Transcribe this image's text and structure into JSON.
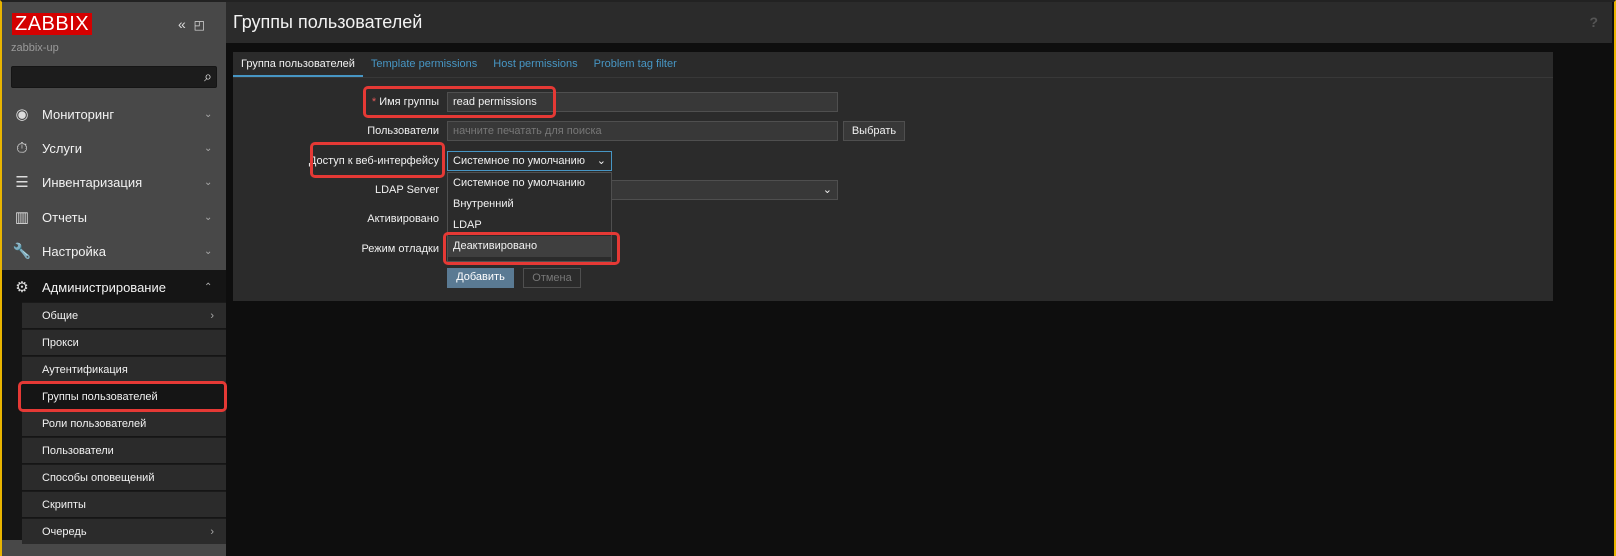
{
  "sidebar": {
    "logo": "ZABBIX",
    "server": "zabbix-up",
    "collapse_icon": "«",
    "kiosk_icon": "◰",
    "menu": [
      {
        "label": "Мониторинг",
        "icon": "eye-icon"
      },
      {
        "label": "Услуги",
        "icon": "timer-icon"
      },
      {
        "label": "Инвентаризация",
        "icon": "list-icon"
      },
      {
        "label": "Отчеты",
        "icon": "chart-icon"
      },
      {
        "label": "Настройка",
        "icon": "wrench-icon"
      },
      {
        "label": "Администрирование",
        "icon": "gear-icon"
      }
    ],
    "submenu": [
      "Общие",
      "Прокси",
      "Аутентификация",
      "Группы пользователей",
      "Роли пользователей",
      "Пользователи",
      "Способы оповещений",
      "Скрипты",
      "Очередь"
    ]
  },
  "header": {
    "title": "Группы пользователей",
    "help": "?"
  },
  "tabs": [
    "Группа пользователей",
    "Template permissions",
    "Host permissions",
    "Problem tag filter"
  ],
  "form": {
    "required_mark": "*",
    "name_label": "Имя группы",
    "name_value": "read permissions",
    "users_label": "Пользователи",
    "users_placeholder": "начните печатать для поиска",
    "select_button": "Выбрать",
    "frontend_label": "Доступ к веб-интерфейсу",
    "frontend_value": "Системное по умолчанию",
    "frontend_options": [
      "Системное по умолчанию",
      "Внутренний",
      "LDAP",
      "Деактивировано"
    ],
    "ldap_label": "LDAP Server",
    "enabled_label": "Активировано",
    "debug_label": "Режим отладки",
    "add_button": "Добавить",
    "cancel_button": "Отмена"
  },
  "colors": {
    "accent": "#4796c4",
    "highlight": "#e53935",
    "logo": "#d40000"
  }
}
